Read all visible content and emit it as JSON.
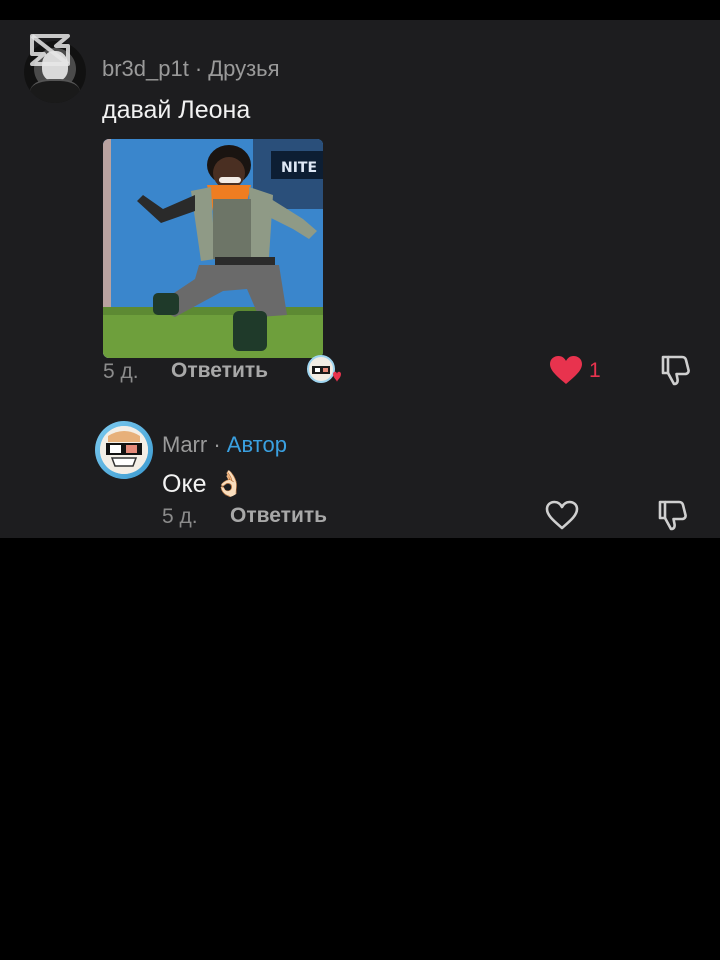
{
  "comment": {
    "username": "br3d_p1t",
    "separator": "·",
    "badge": "Друзья",
    "text": "давай Леона",
    "time": "5 д.",
    "reply_label": "Ответить",
    "like_count": "1",
    "liked": true
  },
  "reply": {
    "username": "Marr",
    "separator": "·",
    "badge": "Автор",
    "text": "Оке 👌🏻",
    "time": "5 д.",
    "reply_label": "Ответить"
  },
  "colors": {
    "background": "#000000",
    "panel": "#1d1d1f",
    "like_red": "#e8334e",
    "author_blue": "#3aa0e0"
  },
  "icons": [
    "capcut-watermark-icon",
    "heart-filled-icon",
    "heart-outline-icon",
    "thumbs-down-icon",
    "creator-liked-avatar-icon"
  ]
}
